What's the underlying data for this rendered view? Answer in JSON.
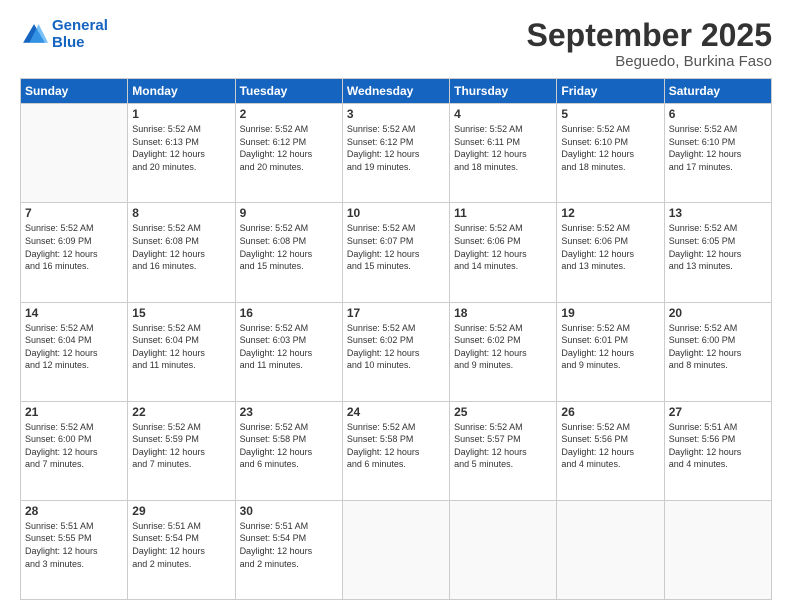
{
  "logo": {
    "line1": "General",
    "line2": "Blue"
  },
  "header": {
    "month": "September 2025",
    "location": "Beguedo, Burkina Faso"
  },
  "weekdays": [
    "Sunday",
    "Monday",
    "Tuesday",
    "Wednesday",
    "Thursday",
    "Friday",
    "Saturday"
  ],
  "weeks": [
    [
      {
        "day": "",
        "info": ""
      },
      {
        "day": "1",
        "info": "Sunrise: 5:52 AM\nSunset: 6:13 PM\nDaylight: 12 hours\nand 20 minutes."
      },
      {
        "day": "2",
        "info": "Sunrise: 5:52 AM\nSunset: 6:12 PM\nDaylight: 12 hours\nand 20 minutes."
      },
      {
        "day": "3",
        "info": "Sunrise: 5:52 AM\nSunset: 6:12 PM\nDaylight: 12 hours\nand 19 minutes."
      },
      {
        "day": "4",
        "info": "Sunrise: 5:52 AM\nSunset: 6:11 PM\nDaylight: 12 hours\nand 18 minutes."
      },
      {
        "day": "5",
        "info": "Sunrise: 5:52 AM\nSunset: 6:10 PM\nDaylight: 12 hours\nand 18 minutes."
      },
      {
        "day": "6",
        "info": "Sunrise: 5:52 AM\nSunset: 6:10 PM\nDaylight: 12 hours\nand 17 minutes."
      }
    ],
    [
      {
        "day": "7",
        "info": "Sunrise: 5:52 AM\nSunset: 6:09 PM\nDaylight: 12 hours\nand 16 minutes."
      },
      {
        "day": "8",
        "info": "Sunrise: 5:52 AM\nSunset: 6:08 PM\nDaylight: 12 hours\nand 16 minutes."
      },
      {
        "day": "9",
        "info": "Sunrise: 5:52 AM\nSunset: 6:08 PM\nDaylight: 12 hours\nand 15 minutes."
      },
      {
        "day": "10",
        "info": "Sunrise: 5:52 AM\nSunset: 6:07 PM\nDaylight: 12 hours\nand 15 minutes."
      },
      {
        "day": "11",
        "info": "Sunrise: 5:52 AM\nSunset: 6:06 PM\nDaylight: 12 hours\nand 14 minutes."
      },
      {
        "day": "12",
        "info": "Sunrise: 5:52 AM\nSunset: 6:06 PM\nDaylight: 12 hours\nand 13 minutes."
      },
      {
        "day": "13",
        "info": "Sunrise: 5:52 AM\nSunset: 6:05 PM\nDaylight: 12 hours\nand 13 minutes."
      }
    ],
    [
      {
        "day": "14",
        "info": "Sunrise: 5:52 AM\nSunset: 6:04 PM\nDaylight: 12 hours\nand 12 minutes."
      },
      {
        "day": "15",
        "info": "Sunrise: 5:52 AM\nSunset: 6:04 PM\nDaylight: 12 hours\nand 11 minutes."
      },
      {
        "day": "16",
        "info": "Sunrise: 5:52 AM\nSunset: 6:03 PM\nDaylight: 12 hours\nand 11 minutes."
      },
      {
        "day": "17",
        "info": "Sunrise: 5:52 AM\nSunset: 6:02 PM\nDaylight: 12 hours\nand 10 minutes."
      },
      {
        "day": "18",
        "info": "Sunrise: 5:52 AM\nSunset: 6:02 PM\nDaylight: 12 hours\nand 9 minutes."
      },
      {
        "day": "19",
        "info": "Sunrise: 5:52 AM\nSunset: 6:01 PM\nDaylight: 12 hours\nand 9 minutes."
      },
      {
        "day": "20",
        "info": "Sunrise: 5:52 AM\nSunset: 6:00 PM\nDaylight: 12 hours\nand 8 minutes."
      }
    ],
    [
      {
        "day": "21",
        "info": "Sunrise: 5:52 AM\nSunset: 6:00 PM\nDaylight: 12 hours\nand 7 minutes."
      },
      {
        "day": "22",
        "info": "Sunrise: 5:52 AM\nSunset: 5:59 PM\nDaylight: 12 hours\nand 7 minutes."
      },
      {
        "day": "23",
        "info": "Sunrise: 5:52 AM\nSunset: 5:58 PM\nDaylight: 12 hours\nand 6 minutes."
      },
      {
        "day": "24",
        "info": "Sunrise: 5:52 AM\nSunset: 5:58 PM\nDaylight: 12 hours\nand 6 minutes."
      },
      {
        "day": "25",
        "info": "Sunrise: 5:52 AM\nSunset: 5:57 PM\nDaylight: 12 hours\nand 5 minutes."
      },
      {
        "day": "26",
        "info": "Sunrise: 5:52 AM\nSunset: 5:56 PM\nDaylight: 12 hours\nand 4 minutes."
      },
      {
        "day": "27",
        "info": "Sunrise: 5:51 AM\nSunset: 5:56 PM\nDaylight: 12 hours\nand 4 minutes."
      }
    ],
    [
      {
        "day": "28",
        "info": "Sunrise: 5:51 AM\nSunset: 5:55 PM\nDaylight: 12 hours\nand 3 minutes."
      },
      {
        "day": "29",
        "info": "Sunrise: 5:51 AM\nSunset: 5:54 PM\nDaylight: 12 hours\nand 2 minutes."
      },
      {
        "day": "30",
        "info": "Sunrise: 5:51 AM\nSunset: 5:54 PM\nDaylight: 12 hours\nand 2 minutes."
      },
      {
        "day": "",
        "info": ""
      },
      {
        "day": "",
        "info": ""
      },
      {
        "day": "",
        "info": ""
      },
      {
        "day": "",
        "info": ""
      }
    ]
  ]
}
